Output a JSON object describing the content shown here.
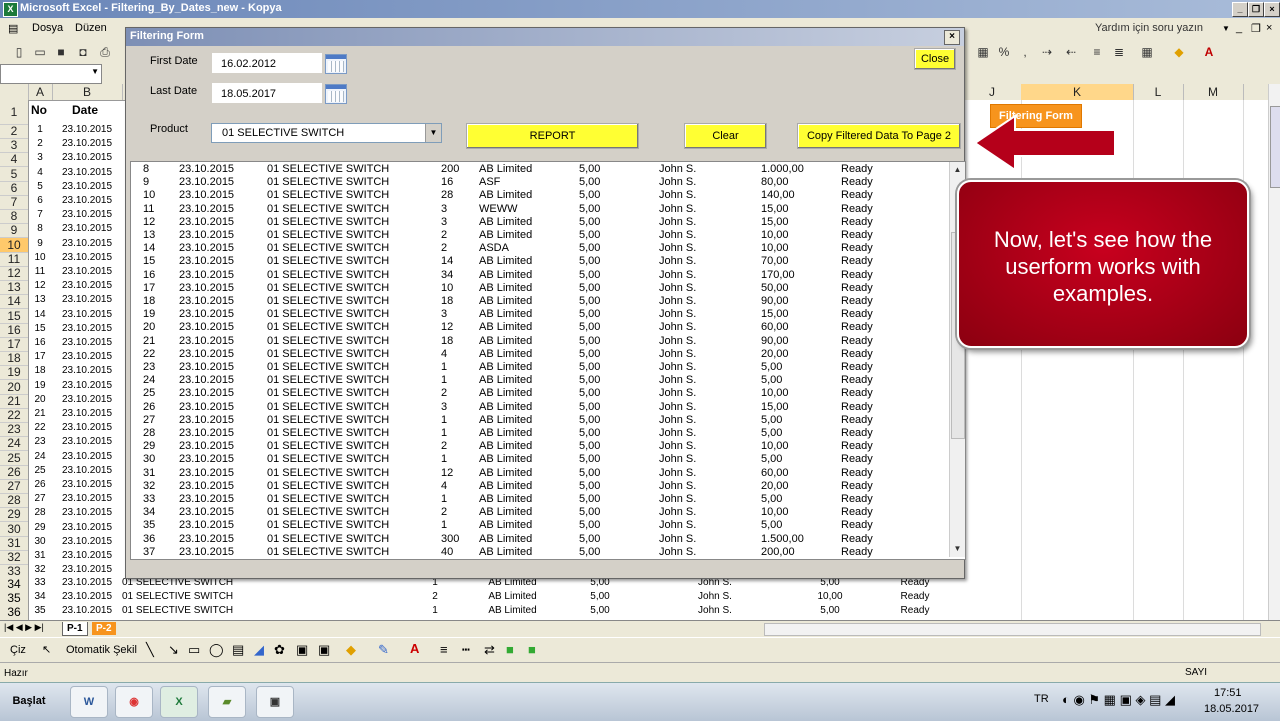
{
  "window": {
    "title": "Microsoft Excel - Filtering_By_Dates_new - Kopya",
    "help_placeholder": "Yardım için soru yazın"
  },
  "menubar": {
    "items": [
      "Dosya",
      "Düzen"
    ]
  },
  "sheet": {
    "columns": [
      "A",
      "B",
      "J",
      "K",
      "L",
      "M"
    ],
    "header": {
      "no": "No",
      "date": "Date"
    },
    "rows": [
      {
        "r": "2",
        "no": "1",
        "date": "23.10.2015"
      },
      {
        "r": "3",
        "no": "2",
        "date": "23.10.2015"
      },
      {
        "r": "4",
        "no": "3",
        "date": "23.10.2015"
      },
      {
        "r": "5",
        "no": "4",
        "date": "23.10.2015"
      },
      {
        "r": "6",
        "no": "5",
        "date": "23.10.2015"
      },
      {
        "r": "7",
        "no": "6",
        "date": "23.10.2015"
      },
      {
        "r": "8",
        "no": "7",
        "date": "23.10.2015"
      },
      {
        "r": "9",
        "no": "8",
        "date": "23.10.2015"
      },
      {
        "r": "10",
        "no": "9",
        "date": "23.10.2015"
      },
      {
        "r": "11",
        "no": "10",
        "date": "23.10.2015"
      },
      {
        "r": "12",
        "no": "11",
        "date": "23.10.2015"
      },
      {
        "r": "13",
        "no": "12",
        "date": "23.10.2015"
      },
      {
        "r": "14",
        "no": "13",
        "date": "23.10.2015"
      },
      {
        "r": "15",
        "no": "14",
        "date": "23.10.2015"
      },
      {
        "r": "16",
        "no": "15",
        "date": "23.10.2015"
      },
      {
        "r": "17",
        "no": "16",
        "date": "23.10.2015"
      },
      {
        "r": "18",
        "no": "17",
        "date": "23.10.2015"
      },
      {
        "r": "19",
        "no": "18",
        "date": "23.10.2015"
      },
      {
        "r": "20",
        "no": "19",
        "date": "23.10.2015"
      },
      {
        "r": "21",
        "no": "20",
        "date": "23.10.2015"
      },
      {
        "r": "22",
        "no": "21",
        "date": "23.10.2015"
      },
      {
        "r": "23",
        "no": "22",
        "date": "23.10.2015"
      },
      {
        "r": "24",
        "no": "23",
        "date": "23.10.2015"
      },
      {
        "r": "25",
        "no": "24",
        "date": "23.10.2015"
      },
      {
        "r": "26",
        "no": "25",
        "date": "23.10.2015"
      },
      {
        "r": "27",
        "no": "26",
        "date": "23.10.2015"
      },
      {
        "r": "28",
        "no": "27",
        "date": "23.10.2015"
      },
      {
        "r": "29",
        "no": "28",
        "date": "23.10.2015"
      },
      {
        "r": "30",
        "no": "29",
        "date": "23.10.2015"
      },
      {
        "r": "31",
        "no": "30",
        "date": "23.10.2015"
      },
      {
        "r": "32",
        "no": "31",
        "date": "23.10.2015"
      },
      {
        "r": "33",
        "no": "32",
        "date": "23.10.2015"
      }
    ],
    "visible_below": [
      {
        "r": "34",
        "no": "33",
        "date": "23.10.2015",
        "product": "01 SELECTIVE SWITCH",
        "qty": "1",
        "company": "AB Limited",
        "price": "5,00",
        "person": "John S.",
        "total": "5,00",
        "status": "Ready"
      },
      {
        "r": "35",
        "no": "34",
        "date": "23.10.2015",
        "product": "01 SELECTIVE SWITCH",
        "qty": "2",
        "company": "AB Limited",
        "price": "5,00",
        "person": "John S.",
        "total": "10,00",
        "status": "Ready"
      },
      {
        "r": "36",
        "no": "35",
        "date": "23.10.2015",
        "product": "01 SELECTIVE SWITCH",
        "qty": "1",
        "company": "AB Limited",
        "price": "5,00",
        "person": "John S.",
        "total": "5,00",
        "status": "Ready"
      }
    ],
    "sheet_button": "Filtering Form",
    "tabs": [
      "P-1",
      "P-2"
    ]
  },
  "drawbar": {
    "draw": "Çiz",
    "autoshapes": "Otomatik Şekil"
  },
  "statusbar": {
    "left": "Hazır",
    "right": "SAYI"
  },
  "taskbar": {
    "start": "Başlat",
    "lang": "TR",
    "time": "17:51",
    "date": "18.05.2017"
  },
  "form": {
    "title": "Filtering Form",
    "first_date_label": "First Date",
    "first_date_value": "16.02.2012",
    "last_date_label": "Last Date",
    "last_date_value": "18.05.2017",
    "product_label": "Product",
    "product_value": "01 SELECTIVE SWITCH",
    "close_label": "Close",
    "report_label": "REPORT",
    "clear_label": "Clear",
    "copy_label": "Copy Filtered Data To Page 2",
    "list": [
      [
        "8",
        "23.10.2015",
        "01 SELECTIVE SWITCH",
        "200",
        "AB Limited",
        "5,00",
        "John S.",
        "1.000,00",
        "Ready"
      ],
      [
        "9",
        "23.10.2015",
        "01 SELECTIVE SWITCH",
        "16",
        "ASF",
        "5,00",
        "John S.",
        "80,00",
        "Ready"
      ],
      [
        "10",
        "23.10.2015",
        "01 SELECTIVE SWITCH",
        "28",
        "AB Limited",
        "5,00",
        "John S.",
        "140,00",
        "Ready"
      ],
      [
        "11",
        "23.10.2015",
        "01 SELECTIVE SWITCH",
        "3",
        "WEWW",
        "5,00",
        "John S.",
        "15,00",
        "Ready"
      ],
      [
        "12",
        "23.10.2015",
        "01 SELECTIVE SWITCH",
        "3",
        "AB Limited",
        "5,00",
        "John S.",
        "15,00",
        "Ready"
      ],
      [
        "13",
        "23.10.2015",
        "01 SELECTIVE SWITCH",
        "2",
        "AB Limited",
        "5,00",
        "John S.",
        "10,00",
        "Ready"
      ],
      [
        "14",
        "23.10.2015",
        "01 SELECTIVE SWITCH",
        "2",
        "ASDA",
        "5,00",
        "John S.",
        "10,00",
        "Ready"
      ],
      [
        "15",
        "23.10.2015",
        "01 SELECTIVE SWITCH",
        "14",
        "AB Limited",
        "5,00",
        "John S.",
        "70,00",
        "Ready"
      ],
      [
        "16",
        "23.10.2015",
        "01 SELECTIVE SWITCH",
        "34",
        "AB Limited",
        "5,00",
        "John S.",
        "170,00",
        "Ready"
      ],
      [
        "17",
        "23.10.2015",
        "01 SELECTIVE SWITCH",
        "10",
        "AB Limited",
        "5,00",
        "John S.",
        "50,00",
        "Ready"
      ],
      [
        "18",
        "23.10.2015",
        "01 SELECTIVE SWITCH",
        "18",
        "AB Limited",
        "5,00",
        "John S.",
        "90,00",
        "Ready"
      ],
      [
        "19",
        "23.10.2015",
        "01 SELECTIVE SWITCH",
        "3",
        "AB Limited",
        "5,00",
        "John S.",
        "15,00",
        "Ready"
      ],
      [
        "20",
        "23.10.2015",
        "01 SELECTIVE SWITCH",
        "12",
        "AB Limited",
        "5,00",
        "John S.",
        "60,00",
        "Ready"
      ],
      [
        "21",
        "23.10.2015",
        "01 SELECTIVE SWITCH",
        "18",
        "AB Limited",
        "5,00",
        "John S.",
        "90,00",
        "Ready"
      ],
      [
        "22",
        "23.10.2015",
        "01 SELECTIVE SWITCH",
        "4",
        "AB Limited",
        "5,00",
        "John S.",
        "20,00",
        "Ready"
      ],
      [
        "23",
        "23.10.2015",
        "01 SELECTIVE SWITCH",
        "1",
        "AB Limited",
        "5,00",
        "John S.",
        "5,00",
        "Ready"
      ],
      [
        "24",
        "23.10.2015",
        "01 SELECTIVE SWITCH",
        "1",
        "AB Limited",
        "5,00",
        "John S.",
        "5,00",
        "Ready"
      ],
      [
        "25",
        "23.10.2015",
        "01 SELECTIVE SWITCH",
        "2",
        "AB Limited",
        "5,00",
        "John S.",
        "10,00",
        "Ready"
      ],
      [
        "26",
        "23.10.2015",
        "01 SELECTIVE SWITCH",
        "3",
        "AB Limited",
        "5,00",
        "John S.",
        "15,00",
        "Ready"
      ],
      [
        "27",
        "23.10.2015",
        "01 SELECTIVE SWITCH",
        "1",
        "AB Limited",
        "5,00",
        "John S.",
        "5,00",
        "Ready"
      ],
      [
        "28",
        "23.10.2015",
        "01 SELECTIVE SWITCH",
        "1",
        "AB Limited",
        "5,00",
        "John S.",
        "5,00",
        "Ready"
      ],
      [
        "29",
        "23.10.2015",
        "01 SELECTIVE SWITCH",
        "2",
        "AB Limited",
        "5,00",
        "John S.",
        "10,00",
        "Ready"
      ],
      [
        "30",
        "23.10.2015",
        "01 SELECTIVE SWITCH",
        "1",
        "AB Limited",
        "5,00",
        "John S.",
        "5,00",
        "Ready"
      ],
      [
        "31",
        "23.10.2015",
        "01 SELECTIVE SWITCH",
        "12",
        "AB Limited",
        "5,00",
        "John S.",
        "60,00",
        "Ready"
      ],
      [
        "32",
        "23.10.2015",
        "01 SELECTIVE SWITCH",
        "4",
        "AB Limited",
        "5,00",
        "John S.",
        "20,00",
        "Ready"
      ],
      [
        "33",
        "23.10.2015",
        "01 SELECTIVE SWITCH",
        "1",
        "AB Limited",
        "5,00",
        "John S.",
        "5,00",
        "Ready"
      ],
      [
        "34",
        "23.10.2015",
        "01 SELECTIVE SWITCH",
        "2",
        "AB Limited",
        "5,00",
        "John S.",
        "10,00",
        "Ready"
      ],
      [
        "35",
        "23.10.2015",
        "01 SELECTIVE SWITCH",
        "1",
        "AB Limited",
        "5,00",
        "John S.",
        "5,00",
        "Ready"
      ],
      [
        "36",
        "23.10.2015",
        "01 SELECTIVE SWITCH",
        "300",
        "AB Limited",
        "5,00",
        "John S.",
        "1.500,00",
        "Ready"
      ],
      [
        "37",
        "23.10.2015",
        "01 SELECTIVE SWITCH",
        "40",
        "AB Limited",
        "5,00",
        "John S.",
        "200,00",
        "Ready"
      ]
    ]
  },
  "callout": {
    "text": "Now, let's see how the userform works with examples."
  },
  "colors": {
    "button_yellow": "#ffff33",
    "callout_red": "#b00018",
    "sheet_button_orange": "#f7941d",
    "selected_row_header": "#ffc96b"
  }
}
